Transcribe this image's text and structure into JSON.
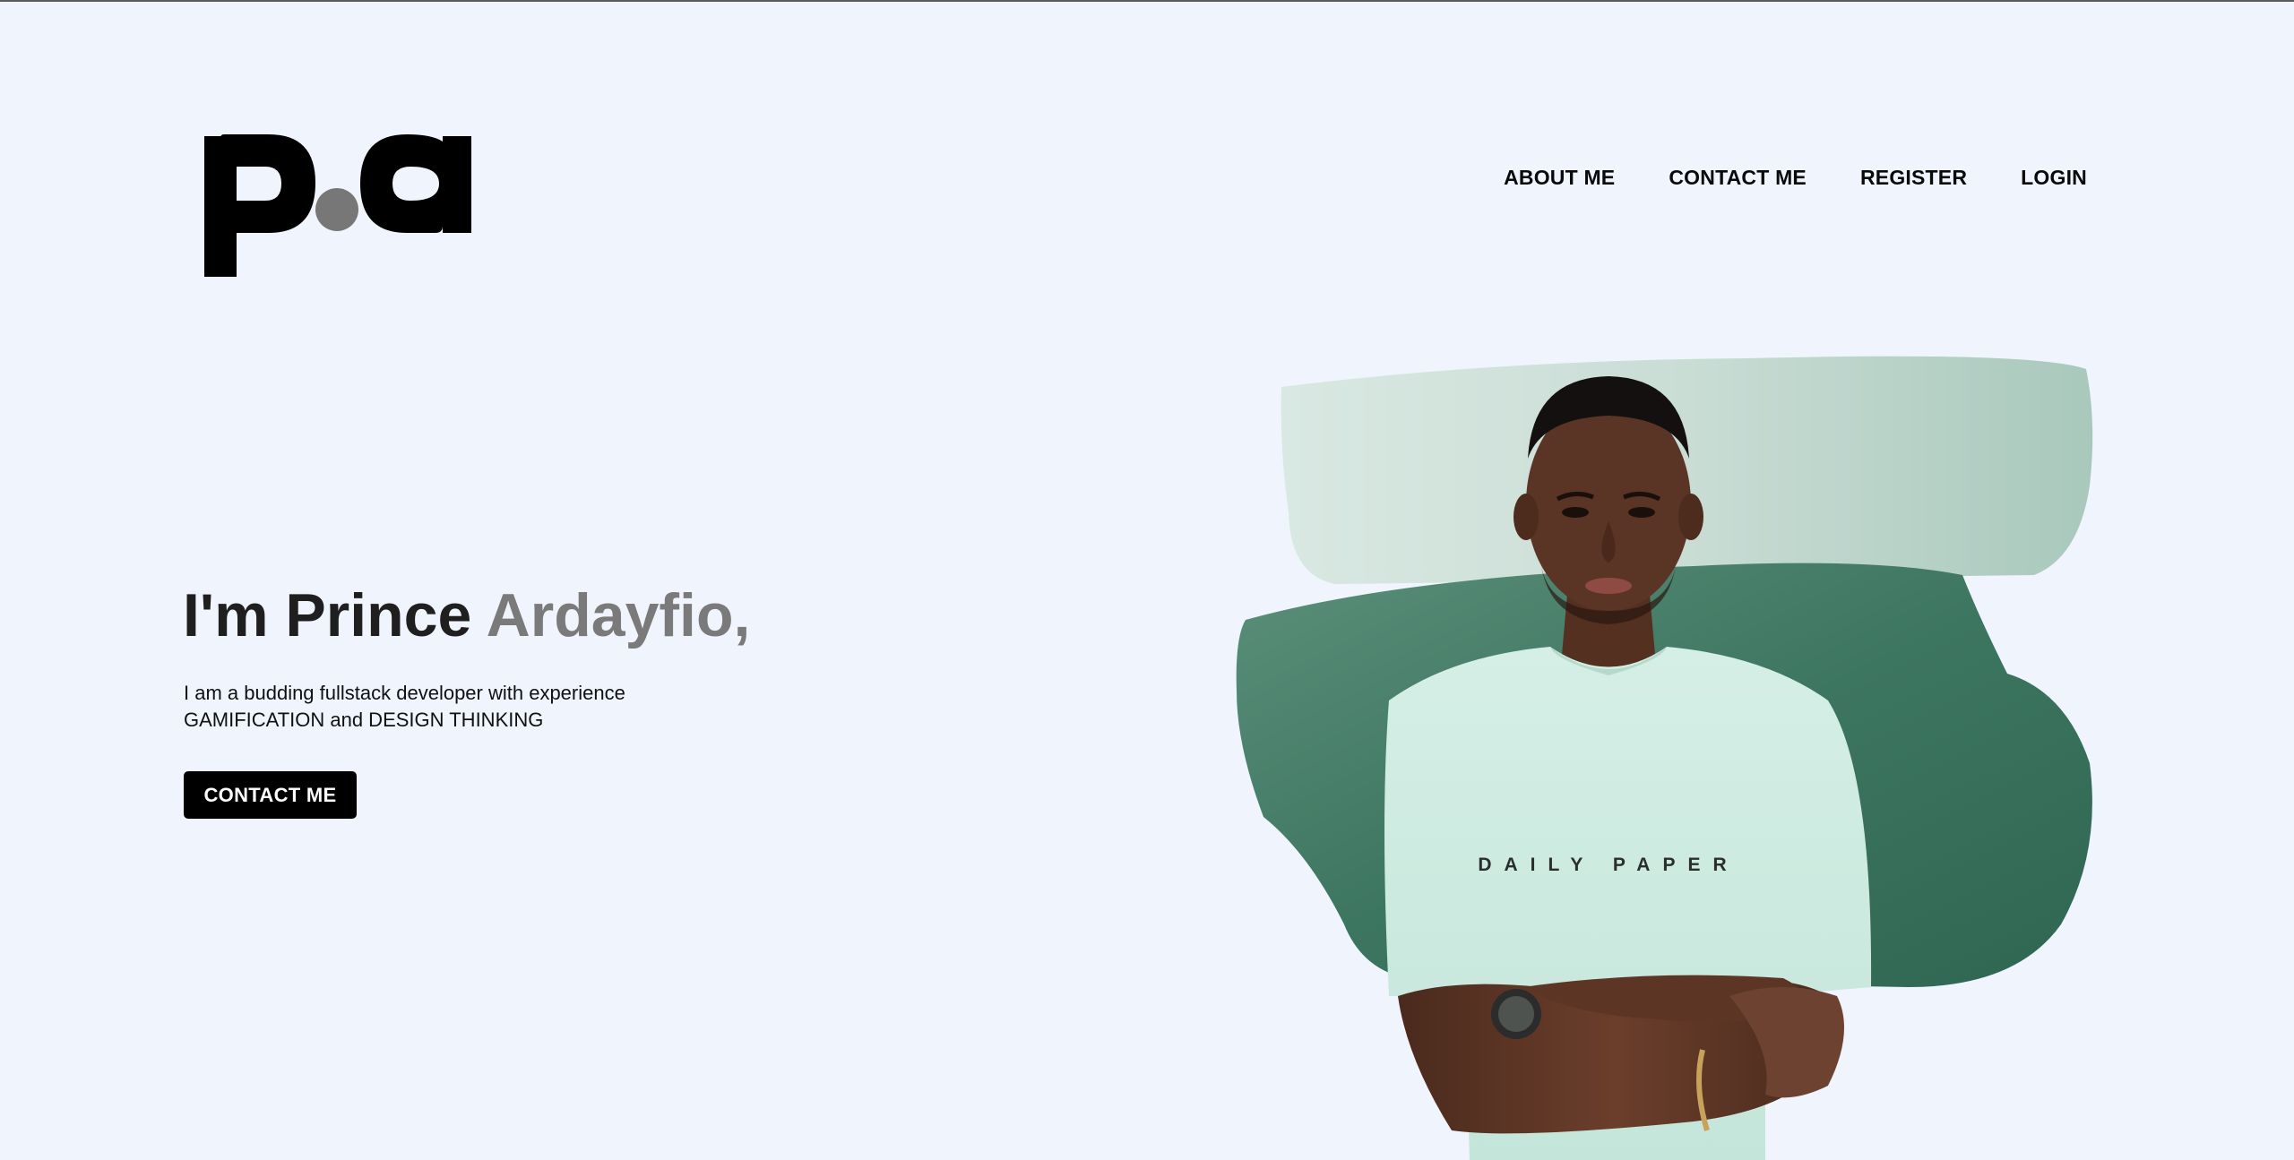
{
  "logo": {
    "letter_left": "p",
    "letter_right": "a",
    "dot_color": "#777777"
  },
  "nav": {
    "items": [
      {
        "label": "ABOUT ME"
      },
      {
        "label": "CONTACT ME"
      },
      {
        "label": "REGISTER"
      },
      {
        "label": "LOGIN"
      }
    ]
  },
  "hero": {
    "title_main": "I'm Prince ",
    "title_accent": "Ardayfio,",
    "description_line1": "I am a budding fullstack developer with experience",
    "description_line2": "GAMIFICATION and DESIGN THINKING",
    "cta_label": "CONTACT ME"
  },
  "portrait": {
    "shirt_text": "DAILY PAPER",
    "brush_light_color": "#cfe3dc",
    "brush_dark_color": "#3f7a62",
    "shirt_color": "#cdebe1",
    "skin_color": "#5a3424"
  },
  "colors": {
    "background": "#eff4fd",
    "text_primary": "#1f1f1f",
    "text_accent": "#7a7a7a",
    "button_bg": "#000000",
    "button_text": "#ffffff"
  }
}
